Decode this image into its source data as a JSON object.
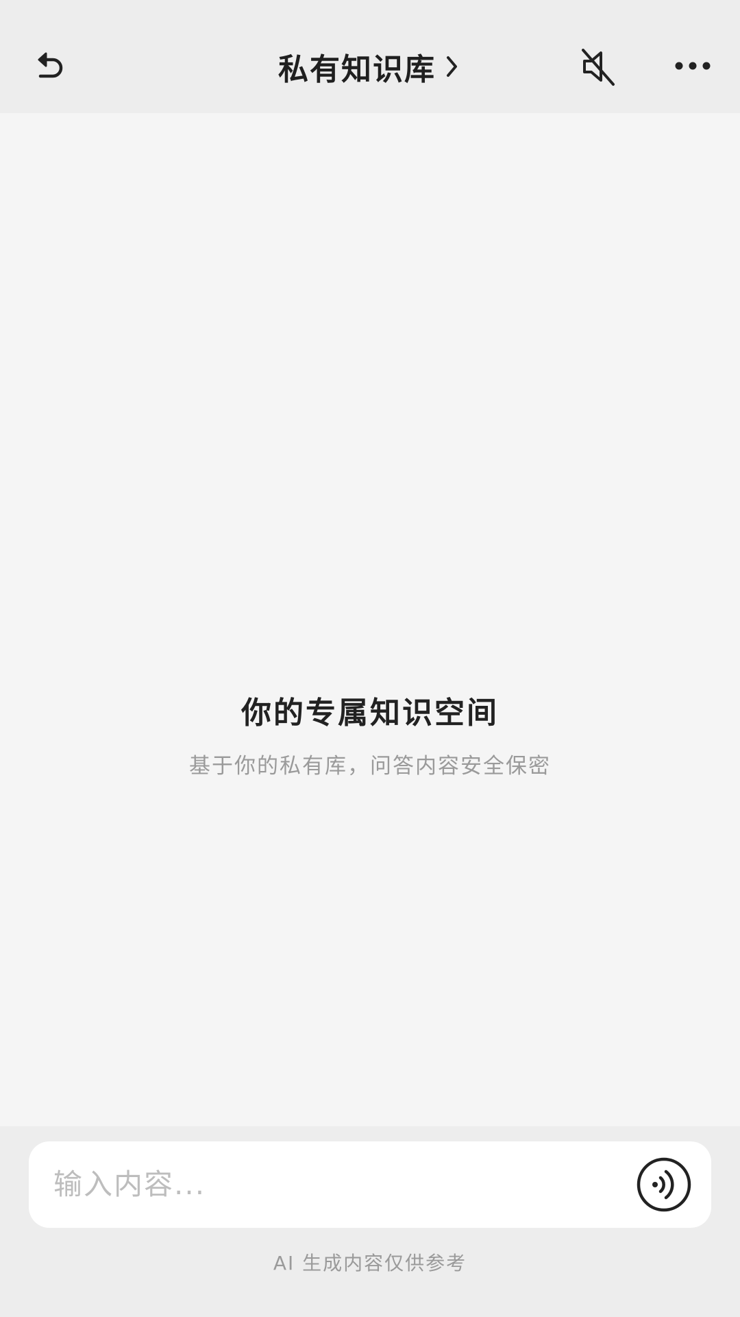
{
  "header": {
    "title": "私有知识库",
    "back_icon": "back-arrow-icon",
    "chevron_icon": "chevron-right-icon",
    "mute_icon": "speaker-muted-icon",
    "more_icon": "more-horizontal-icon"
  },
  "empty_state": {
    "title": "你的专属知识空间",
    "subtitle": "基于你的私有库，问答内容安全保密"
  },
  "composer": {
    "placeholder": "输入内容...",
    "voice_icon": "voice-input-icon"
  },
  "footer": {
    "disclaimer": "AI 生成内容仅供参考"
  },
  "colors": {
    "header_bg": "#ededed",
    "page_bg": "#f5f5f5",
    "text_primary": "#222222",
    "text_secondary": "#9a9a9a",
    "input_bg": "#ffffff"
  }
}
